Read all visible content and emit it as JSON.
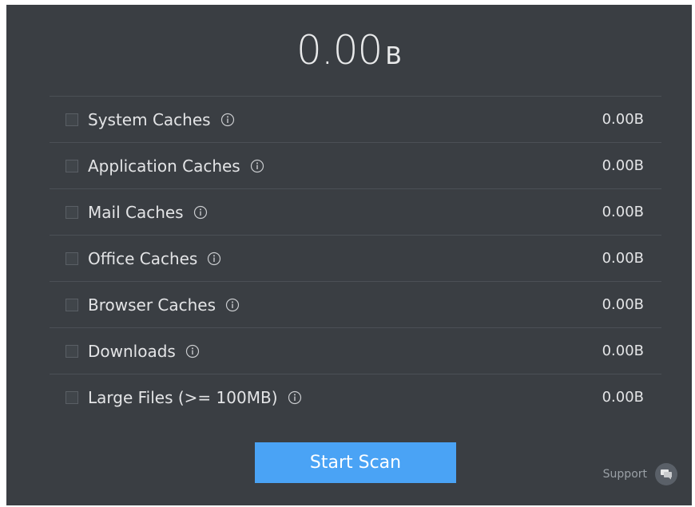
{
  "summary": {
    "total_value": "0.00",
    "total_unit": "B"
  },
  "categories": [
    {
      "label": "System Caches",
      "size": "0.00B",
      "checked": false
    },
    {
      "label": "Application Caches",
      "size": "0.00B",
      "checked": false
    },
    {
      "label": "Mail Caches",
      "size": "0.00B",
      "checked": false
    },
    {
      "label": "Office Caches",
      "size": "0.00B",
      "checked": false
    },
    {
      "label": "Browser Caches",
      "size": "0.00B",
      "checked": false
    },
    {
      "label": "Downloads",
      "size": "0.00B",
      "checked": false
    },
    {
      "label": "Large Files (>= 100MB)",
      "size": "0.00B",
      "checked": false
    }
  ],
  "actions": {
    "start_scan_label": "Start Scan"
  },
  "footer": {
    "support_label": "Support"
  },
  "icons": {
    "info": "info-icon",
    "support": "chat-bubble-icon"
  },
  "colors": {
    "background": "#3a3e43",
    "accent": "#4aa3f5",
    "text": "#e3e4e6"
  }
}
